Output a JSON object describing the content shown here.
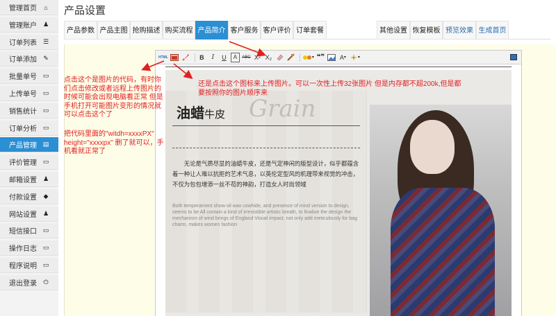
{
  "sidebar": {
    "items": [
      {
        "label": "管理首页",
        "icon": "home-icon",
        "glyph": "⌂"
      },
      {
        "label": "管理账户",
        "icon": "user-icon",
        "glyph": "♟"
      },
      {
        "label": "订单列表",
        "icon": "list-icon",
        "glyph": "☰"
      },
      {
        "label": "订单添加",
        "icon": "edit-icon",
        "glyph": "✎"
      },
      {
        "label": "批量单号",
        "icon": "window-icon",
        "glyph": "▭"
      },
      {
        "label": "上传单号",
        "icon": "window-icon",
        "glyph": "▭"
      },
      {
        "label": "销售统计",
        "icon": "window-icon",
        "glyph": "▭"
      },
      {
        "label": "订单分析",
        "icon": "window-icon",
        "glyph": "▭"
      },
      {
        "label": "产品管理",
        "icon": "box-icon",
        "glyph": "▤",
        "active": true
      },
      {
        "label": "评价管理",
        "icon": "window-icon",
        "glyph": "▭"
      },
      {
        "label": "邮箱设置",
        "icon": "users-icon",
        "glyph": "♟"
      },
      {
        "label": "付款设置",
        "icon": "tag-icon",
        "glyph": "◆"
      },
      {
        "label": "网站设置",
        "icon": "user-icon",
        "glyph": "♟"
      },
      {
        "label": "短信接口",
        "icon": "window-icon",
        "glyph": "▭"
      },
      {
        "label": "操作日志",
        "icon": "window-icon",
        "glyph": "▭"
      },
      {
        "label": "程序说明",
        "icon": "window-icon",
        "glyph": "▭"
      },
      {
        "label": "退出登录",
        "icon": "power-icon",
        "glyph": "⏻"
      }
    ]
  },
  "header": {
    "title": "产品设置"
  },
  "tabs": {
    "left": [
      "产品参数",
      "产品主图",
      "抢购描述",
      "购买流程",
      "产品简介",
      "客户服务",
      "客户评价",
      "订单套餐"
    ],
    "right": [
      "其他设置",
      "恢复模板",
      "预览效果",
      "生成首页"
    ],
    "active": "产品简介"
  },
  "toolbar": {
    "html_label": "HTML",
    "bold": "B",
    "italic": "I",
    "underline": "U",
    "font_color": "A",
    "strike": "ABC",
    "superscript": "X²",
    "subscript": "X₂",
    "quote": "❝❞",
    "font_size": "A"
  },
  "document": {
    "title_main": "油蜡",
    "title_sub": "牛皮",
    "script_word": "Grain",
    "cn_desc": "无论是气质尽显的油蜡牛皮，还是气定神闲的版型设计，似乎都蕴含着一种让人难以抗拒的艺术气息，以英伦定型风的机理带来视觉的冲击，不仅为包包增添一丝不苟的神韵，打造女人时尚领域",
    "en_desc": "Both temperament show oil wax cowhide, and presence of mind version to design, seems to be All contain a kind of irresistible artistic breath, to finalize the design the mechanism of wind brings of England Visual impact, not only add meticulously for bag charm, makes women fashion"
  },
  "annotations": {
    "note1": "点击这个是图片的代码，有时你们点击修改或者远程上传图片的时候可能会出现电脑看正常 但是手机打开可能图片变形的情况就可以点击这个了",
    "note2": "还是点击这个图标来上传图片。可以一次性上传32张图片 但是内存都不超200k,但是都要按照你的图片顺序来",
    "note3": "把代码里面的\"witdh=xxxxPX\" height=\"xxxxpx\" 删了就可以，手机看就正常了"
  },
  "colors": {
    "accent": "#2b8fd3",
    "annotation": "#e02020",
    "content_bg": "#fefde8"
  }
}
